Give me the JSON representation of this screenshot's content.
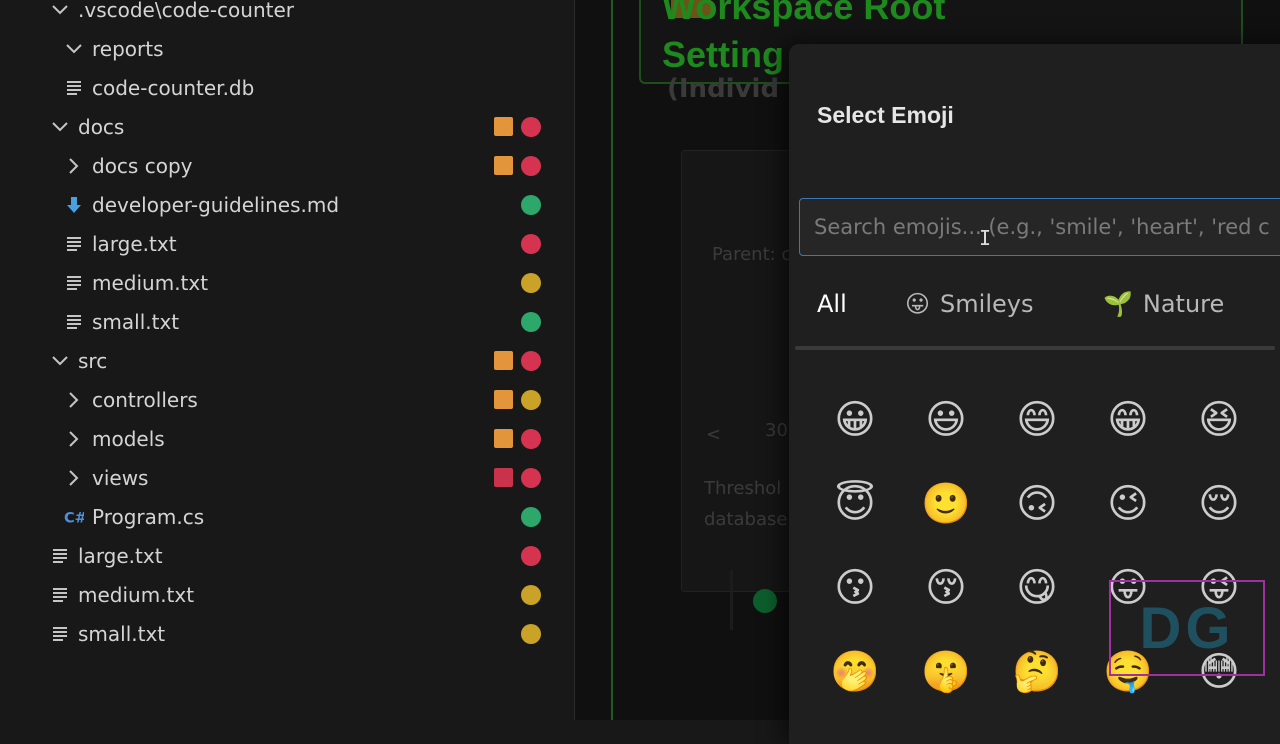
{
  "explorer": {
    "rows": [
      {
        "label": ".vscode\\code-counter",
        "kind": "folder-open",
        "indent": 1,
        "deco": []
      },
      {
        "label": "reports",
        "kind": "folder-open",
        "indent": 2,
        "deco": []
      },
      {
        "label": "code-counter.db",
        "kind": "file",
        "indent": 2,
        "deco": []
      },
      {
        "label": "docs",
        "kind": "folder-open",
        "indent": 1,
        "deco": [
          "sq-orange",
          "dot-red"
        ]
      },
      {
        "label": "docs copy",
        "kind": "folder-closed",
        "indent": 2,
        "deco": [
          "sq-orange",
          "dot-red"
        ]
      },
      {
        "label": "developer-guidelines.md",
        "kind": "md-file",
        "indent": 2,
        "deco": [
          "dot-green"
        ]
      },
      {
        "label": "large.txt",
        "kind": "file",
        "indent": 2,
        "deco": [
          "dot-red"
        ]
      },
      {
        "label": "medium.txt",
        "kind": "file",
        "indent": 2,
        "deco": [
          "dot-yellow"
        ]
      },
      {
        "label": "small.txt",
        "kind": "file",
        "indent": 2,
        "deco": [
          "dot-green"
        ]
      },
      {
        "label": "src",
        "kind": "folder-open",
        "indent": 1,
        "deco": [
          "sq-orange",
          "dot-red"
        ]
      },
      {
        "label": "controllers",
        "kind": "folder-closed",
        "indent": 2,
        "deco": [
          "sq-orange",
          "dot-yellow"
        ]
      },
      {
        "label": "models",
        "kind": "folder-closed",
        "indent": 2,
        "deco": [
          "sq-orange",
          "dot-red"
        ]
      },
      {
        "label": "views",
        "kind": "folder-closed",
        "indent": 2,
        "deco": [
          "sq-red",
          "dot-red"
        ]
      },
      {
        "label": "Program.cs",
        "kind": "cs-file",
        "indent": 2,
        "deco": [
          "dot-green"
        ]
      },
      {
        "label": "large.txt",
        "kind": "file",
        "indent": 1,
        "deco": [
          "dot-red"
        ]
      },
      {
        "label": "medium.txt",
        "kind": "file",
        "indent": 1,
        "deco": [
          "dot-yellow"
        ]
      },
      {
        "label": "small.txt",
        "kind": "file",
        "indent": 1,
        "deco": [
          "dot-yellow"
        ]
      }
    ]
  },
  "colors": {
    "sq-orange": "#e3953b",
    "sq-red": "#c9324b",
    "dot-red": "#d63350",
    "dot-green": "#2ea86a",
    "dot-yellow": "#c9a227",
    "md-icon": "#4a9fe0",
    "cs-icon": "#4f8fd8"
  },
  "editor": {
    "title_line1": "Workspace Root",
    "title_line2": "Setting",
    "subtitle": "(Individ",
    "parent_label": "Parent: c",
    "chevron": "<",
    "num": "30",
    "threshold_1": "Threshol",
    "threshold_2": "database"
  },
  "emoji_modal": {
    "title": "Select Emoji",
    "search_placeholder": "Search emojis... (e.g., 'smile', 'heart', 'red c",
    "tabs": [
      {
        "label": "All",
        "icon": ""
      },
      {
        "label": "Smileys",
        "icon": "😛"
      },
      {
        "label": "Nature",
        "icon": "🌱"
      }
    ],
    "emojis": [
      [
        "😀",
        "😃",
        "😄",
        "😁",
        "😆"
      ],
      [
        "😇",
        "🙂",
        "🙃",
        "😉",
        "😌"
      ],
      [
        "😗",
        "😚",
        "😋",
        "😛",
        "😜"
      ],
      [
        "🤭",
        "🤫",
        "🤔",
        "🤤",
        "😳"
      ]
    ],
    "watermark": "DG"
  }
}
